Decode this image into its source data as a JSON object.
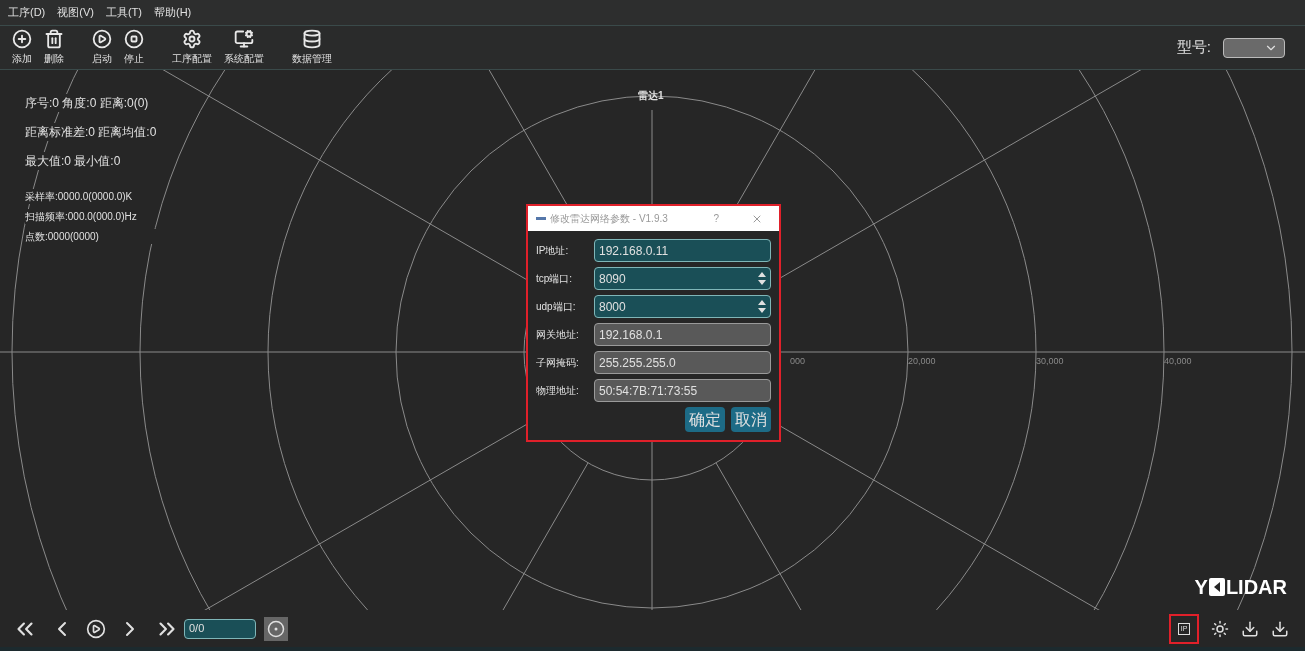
{
  "menu": [
    "工序(D)",
    "视图(V)",
    "工具(T)",
    "帮助(H)"
  ],
  "toolbar": [
    {
      "label": "添加",
      "kind": "add"
    },
    {
      "label": "删除",
      "kind": "delete"
    },
    {
      "label": "启动",
      "kind": "start"
    },
    {
      "label": "停止",
      "kind": "stop"
    },
    {
      "label": "工序配置",
      "kind": "gear"
    },
    {
      "label": "系统配置",
      "kind": "monitor"
    },
    {
      "label": "数据管理",
      "kind": "database"
    }
  ],
  "model": {
    "label": "型号:"
  },
  "readouts": [
    "序号:0 角度:0 距离:0(0)",
    "距离标准差:0 距离均值:0",
    "最大值:0 最小值:0"
  ],
  "stats": [
    "采样率:0000.0(0000.0)K",
    "扫描频率:000.0(000.0)Hz",
    "点数:0000(0000)"
  ],
  "radar": {
    "title": "雷达1",
    "axis_labels": [
      "000",
      "20,000",
      "30,000",
      "40,000"
    ]
  },
  "dialog": {
    "title": "修改雷达网络参数 - V1.9.3",
    "help": "?",
    "highlighted": true,
    "fields": [
      {
        "label": "IP地址:",
        "value": "192.168.0.11",
        "kind": "text",
        "editable": true
      },
      {
        "label": "tcp端口:",
        "value": "8090",
        "kind": "spin",
        "editable": true
      },
      {
        "label": "udp端口:",
        "value": "8000",
        "kind": "spin",
        "editable": true
      },
      {
        "label": "网关地址:",
        "value": "192.168.0.1",
        "kind": "text",
        "editable": false
      },
      {
        "label": "子网掩码:",
        "value": "255.255.255.0",
        "kind": "text",
        "editable": false
      },
      {
        "label": "物理地址:",
        "value": "50:54:7B:71:73:55",
        "kind": "text",
        "editable": false
      }
    ],
    "buttons": [
      "确定",
      "取消"
    ]
  },
  "playback": {
    "position": "0/0"
  },
  "logo": {
    "prefix": "Y",
    "suffix": "LIDAR"
  },
  "ip_button": {
    "label": "IP",
    "highlighted": true
  }
}
